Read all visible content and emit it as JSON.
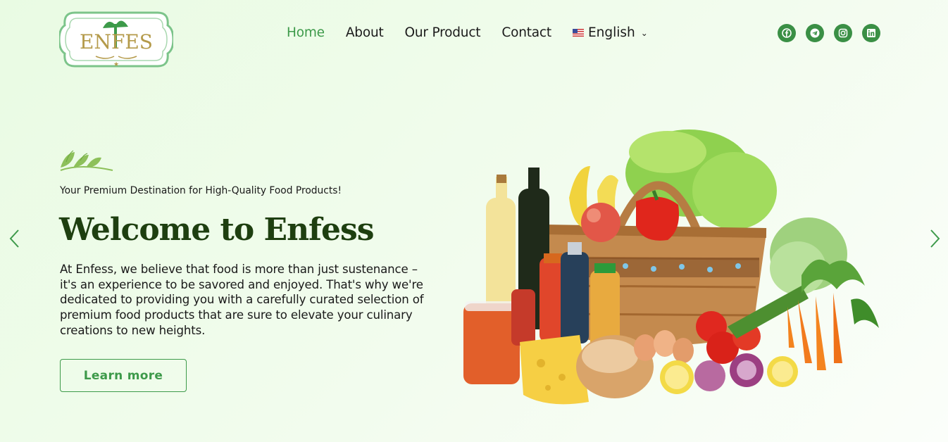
{
  "brand": {
    "logo_text": "ENFES"
  },
  "nav": {
    "items": [
      {
        "label": "Home",
        "active": true
      },
      {
        "label": "About",
        "active": false
      },
      {
        "label": "Our Product",
        "active": false
      },
      {
        "label": "Contact",
        "active": false
      }
    ],
    "language": "English"
  },
  "social": [
    "facebook-icon",
    "telegram-icon",
    "instagram-icon",
    "linkedin-icon"
  ],
  "hero": {
    "tagline": "Your Premium Destination for High-Quality Food Products!",
    "title": "Welcome to Enfess",
    "description": "At Enfess, we believe that food is more than just sustenance – it's an experience to be savored and enjoyed. That's why we're dedicated to providing you with a carefully curated selection of premium food products that are sure to elevate your culinary creations to new heights.",
    "cta": "Learn more"
  },
  "colors": {
    "accent": "#3d9a4a",
    "heading": "#1e3f10",
    "social_bg": "#3a8f45"
  }
}
